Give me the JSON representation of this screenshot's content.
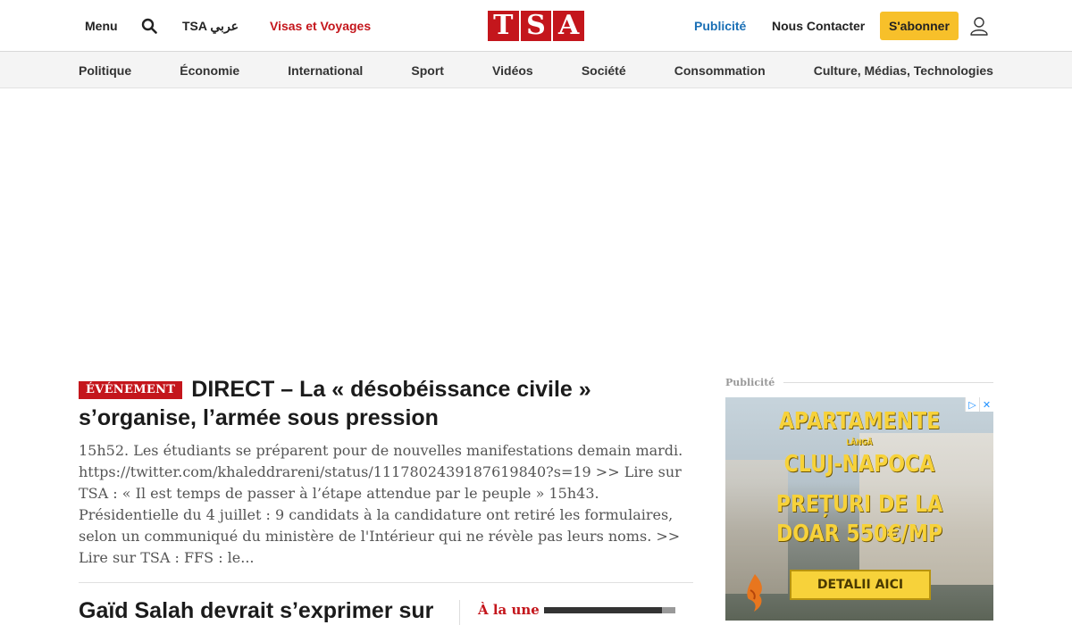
{
  "header": {
    "menu_label": "Menu",
    "arabic_link": "TSA عربي",
    "visas_link": "Visas et Voyages",
    "logo_letters": [
      "T",
      "S",
      "A"
    ],
    "publicite_link": "Publicité",
    "contact_link": "Nous Contacter",
    "subscribe_label": "S'abonner",
    "accent_color": "#c4161c",
    "link_blue": "#1a6fb5",
    "subscribe_color": "#f7c02a",
    "icons": [
      "search-icon",
      "user-icon"
    ]
  },
  "sections": [
    "Politique",
    "Économie",
    "International",
    "Sport",
    "Vidéos",
    "Société",
    "Consommation",
    "Culture, Médias, Technologies"
  ],
  "lead_article": {
    "badge": "ÉVÉNEMENT",
    "title": "DIRECT – La « désobéissance civile » s’organise, l’armée sous pression",
    "excerpt": "15h52. Les étudiants se préparent pour de nouvelles manifestations demain mardi. https://twitter.com/khaleddrareni/status/1117802439187619840?s=19 >> Lire sur TSA : « Il est temps de passer à l’étape attendue par le peuple » 15h43. Présidentielle du 4 juillet : 9 candidats à la candidature ont retiré les formulaires, selon un communiqué du ministère de l'Intérieur qui ne révèle pas leurs noms. >> Lire sur TSA : FFS : le..."
  },
  "second_article": {
    "title": "Gaïd Salah devrait s’exprimer sur"
  },
  "a_la_une": {
    "label": "À la une",
    "progress": 0.1
  },
  "sidebar_ad": {
    "label": "Publicité",
    "line1": "APARTAMENTE",
    "line2": "LÂNGĂ",
    "line3": "CLUJ-NAPOCA",
    "line4": "PREȚURI DE LA",
    "line5": "DOAR 550€/MP",
    "cta": "DETALII AICI",
    "choices_play": "▷",
    "choices_close": "✕"
  }
}
